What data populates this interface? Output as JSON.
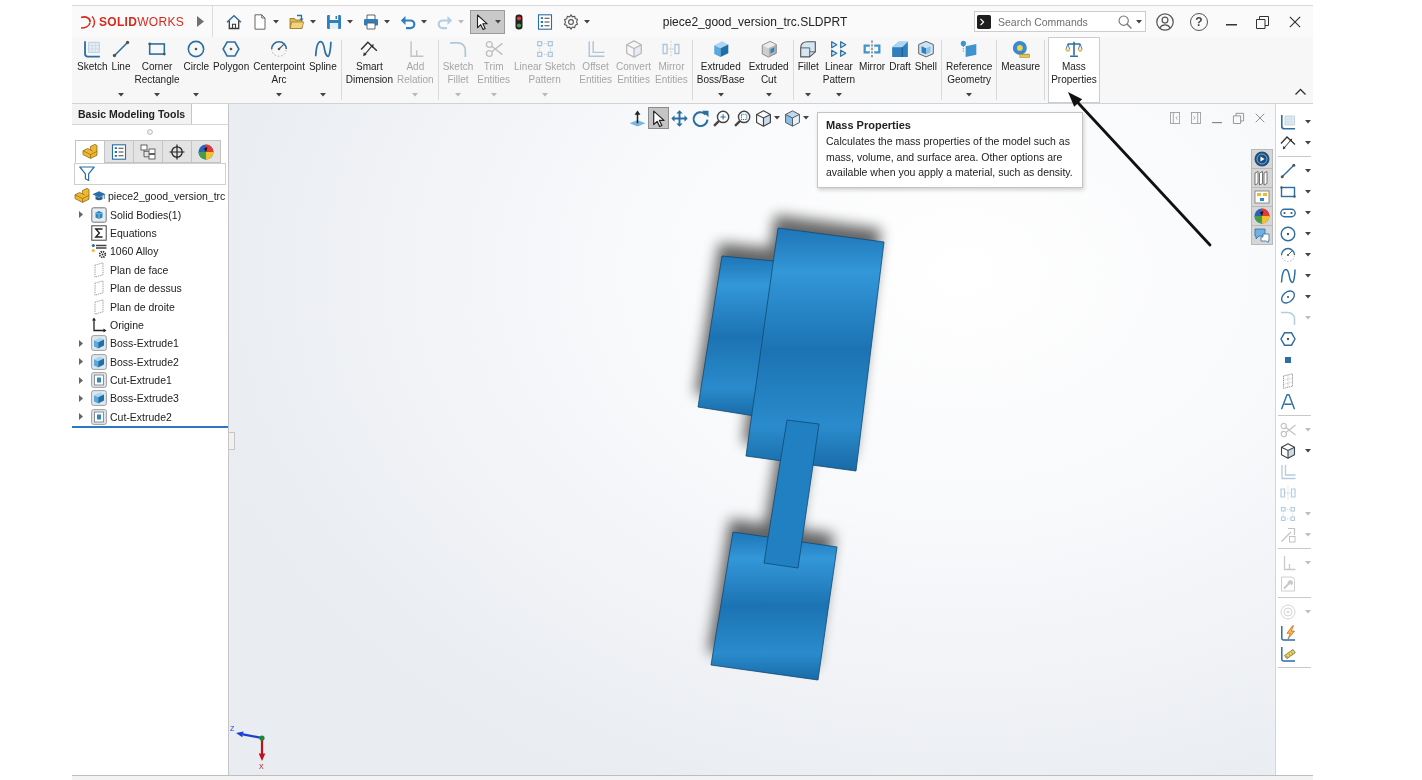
{
  "title_bar": {
    "logo": "**SOLID**WORKS",
    "quick_access": [
      {
        "dropdown": false,
        "disabled": false,
        "pressed": false
      },
      {
        "dropdown": true,
        "disabled": false,
        "pressed": false
      },
      {
        "dropdown": true,
        "disabled": false,
        "pressed": false
      },
      {
        "dropdown": true,
        "disabled": false,
        "pressed": false
      },
      {
        "dropdown": true,
        "disabled": false,
        "pressed": false
      },
      {
        "dropdown": true,
        "disabled": false,
        "pressed": false
      },
      {
        "dropdown": true,
        "disabled": true,
        "pressed": false
      },
      {
        "dropdown": true,
        "disabled": false,
        "pressed": true
      },
      {
        "dropdown": false,
        "disabled": false,
        "pressed": false
      },
      {
        "dropdown": false,
        "disabled": false,
        "pressed": false
      },
      {
        "dropdown": true,
        "disabled": false,
        "pressed": false
      }
    ],
    "document_title": "piece2_good_version_trc.SLDPRT",
    "search": {
      "placeholder": "Search Commands"
    },
    "help": "?"
  },
  "ribbon": {
    "groups": [
      {
        "buttons": [
          {
            "lines": [
              "Sketch"
            ],
            "dropdown": false,
            "disabled": false,
            "selected": false
          },
          {
            "lines": [
              "Line"
            ],
            "dropdown": true,
            "disabled": false,
            "selected": false
          },
          {
            "lines": [
              "Corner",
              "Rectangle"
            ],
            "dropdown": true,
            "disabled": false,
            "selected": false
          },
          {
            "lines": [
              "Circle"
            ],
            "dropdown": true,
            "disabled": false,
            "selected": false
          },
          {
            "lines": [
              "Polygon"
            ],
            "dropdown": false,
            "disabled": false,
            "selected": false
          },
          {
            "lines": [
              "Centerpoint",
              "Arc"
            ],
            "dropdown": true,
            "disabled": false,
            "selected": false
          },
          {
            "lines": [
              "Spline"
            ],
            "dropdown": true,
            "disabled": false,
            "selected": false
          }
        ]
      },
      {
        "buttons": [
          {
            "lines": [
              "Smart",
              "Dimension"
            ],
            "dropdown": false,
            "disabled": false,
            "selected": false
          },
          {
            "lines": [
              "Add",
              "Relation"
            ],
            "dropdown": true,
            "disabled": true,
            "selected": false
          }
        ]
      },
      {
        "buttons": [
          {
            "lines": [
              "Sketch",
              "Fillet"
            ],
            "dropdown": true,
            "disabled": true,
            "selected": false
          },
          {
            "lines": [
              "Trim",
              "Entities"
            ],
            "dropdown": true,
            "disabled": true,
            "selected": false
          },
          {
            "lines": [
              "Linear Sketch",
              "Pattern"
            ],
            "dropdown": true,
            "disabled": true,
            "selected": false
          },
          {
            "lines": [
              "Offset",
              "Entities"
            ],
            "dropdown": false,
            "disabled": true,
            "selected": false
          },
          {
            "lines": [
              "Convert",
              "Entities"
            ],
            "dropdown": false,
            "disabled": true,
            "selected": false
          },
          {
            "lines": [
              "Mirror",
              "Entities"
            ],
            "dropdown": false,
            "disabled": true,
            "selected": false
          }
        ]
      },
      {
        "buttons": [
          {
            "lines": [
              "Extruded",
              "Boss/Base"
            ],
            "dropdown": true,
            "disabled": false,
            "selected": false
          },
          {
            "lines": [
              "Extruded",
              "Cut"
            ],
            "dropdown": true,
            "disabled": false,
            "selected": false
          }
        ]
      },
      {
        "buttons": [
          {
            "lines": [
              "Fillet"
            ],
            "dropdown": true,
            "disabled": false,
            "selected": false
          },
          {
            "lines": [
              "Linear",
              "Pattern"
            ],
            "dropdown": true,
            "disabled": false,
            "selected": false
          },
          {
            "lines": [
              "Mirror"
            ],
            "dropdown": false,
            "disabled": false,
            "selected": false
          },
          {
            "lines": [
              "Draft"
            ],
            "dropdown": false,
            "disabled": false,
            "selected": false
          },
          {
            "lines": [
              "Shell"
            ],
            "dropdown": false,
            "disabled": false,
            "selected": false
          }
        ]
      },
      {
        "buttons": [
          {
            "lines": [
              "Reference",
              "Geometry"
            ],
            "dropdown": true,
            "disabled": false,
            "selected": false
          }
        ]
      },
      {
        "buttons": [
          {
            "lines": [
              "Measure"
            ],
            "dropdown": false,
            "disabled": false,
            "selected": false
          }
        ]
      },
      {
        "buttons": [
          {
            "lines": [
              "Mass",
              "Properties"
            ],
            "dropdown": false,
            "disabled": false,
            "selected": true
          }
        ]
      }
    ]
  },
  "left_panel": {
    "tabs": [
      {
        "label": "Basic Modeling Tools",
        "selected": true
      }
    ],
    "manager_tabs": [
      {
        "selected": true
      },
      {
        "selected": false
      },
      {
        "selected": false
      },
      {
        "selected": false
      },
      {
        "selected": false
      }
    ],
    "tree": [
      {
        "label": "piece2_good_version_trc",
        "kind": "part",
        "expandable": false,
        "children": [
          {
            "label": "Solid Bodies(1)",
            "kind": "bodies",
            "expandable": true
          },
          {
            "label": "Equations",
            "kind": "equations",
            "expandable": false
          },
          {
            "label": "1060 Alloy",
            "kind": "material",
            "expandable": false
          },
          {
            "label": "Plan de face",
            "kind": "plane",
            "expandable": false
          },
          {
            "label": "Plan de dessus",
            "kind": "plane",
            "expandable": false
          },
          {
            "label": "Plan de droite",
            "kind": "plane",
            "expandable": false
          },
          {
            "label": "Origine",
            "kind": "origin",
            "expandable": false
          },
          {
            "label": "Boss-Extrude1",
            "kind": "boss",
            "expandable": true
          },
          {
            "label": "Boss-Extrude2",
            "kind": "boss",
            "expandable": true
          },
          {
            "label": "Cut-Extrude1",
            "kind": "cut",
            "expandable": true
          },
          {
            "label": "Boss-Extrude3",
            "kind": "boss",
            "expandable": true
          },
          {
            "label": "Cut-Extrude2",
            "kind": "cut",
            "expandable": true
          }
        ]
      }
    ]
  },
  "viewport": {
    "view_toolbar": [
      {
        "dropdown": false,
        "pressed": false
      },
      {
        "dropdown": false,
        "pressed": true
      },
      {
        "dropdown": false,
        "pressed": false
      },
      {
        "dropdown": false,
        "pressed": false
      },
      {
        "dropdown": false,
        "pressed": false
      },
      {
        "dropdown": false,
        "pressed": false
      },
      {
        "dropdown": true,
        "pressed": false
      },
      {
        "dropdown": true,
        "pressed": false
      }
    ],
    "tooltip": {
      "title": "Mass Properties",
      "text": "Calculates the mass properties of the model such as mass, volume, and surface area. Other options are available when you apply a material, such as density."
    },
    "triad": {
      "axes": [
        {
          "label": "Z",
          "color": "#1c3fd1"
        },
        {
          "label": "X",
          "color": "#c0101c"
        }
      ]
    }
  },
  "right_toolbar": {
    "groups": [
      {
        "items": [
          {
            "dropdown": true,
            "disabled": false
          },
          {
            "dropdown": true,
            "disabled": false
          }
        ]
      },
      {
        "items": [
          {
            "dropdown": true,
            "disabled": false
          },
          {
            "dropdown": true,
            "disabled": false
          },
          {
            "dropdown": true,
            "disabled": false
          },
          {
            "dropdown": true,
            "disabled": false
          },
          {
            "dropdown": true,
            "disabled": false
          },
          {
            "dropdown": true,
            "disabled": false
          },
          {
            "dropdown": true,
            "disabled": false
          },
          {
            "dropdown": true,
            "disabled": true
          },
          {
            "dropdown": false,
            "disabled": false
          },
          {
            "dropdown": false,
            "disabled": false
          },
          {
            "dropdown": false,
            "disabled": false
          },
          {
            "dropdown": false,
            "disabled": false
          }
        ]
      },
      {
        "items": [
          {
            "dropdown": true,
            "disabled": true
          },
          {
            "dropdown": true,
            "disabled": false
          },
          {
            "dropdown": false,
            "disabled": true
          },
          {
            "dropdown": false,
            "disabled": true
          },
          {
            "dropdown": true,
            "disabled": true
          },
          {
            "dropdown": true,
            "disabled": true
          }
        ]
      },
      {
        "items": [
          {
            "dropdown": true,
            "disabled": true
          },
          {
            "dropdown": false,
            "disabled": true
          }
        ]
      },
      {
        "items": [
          {
            "dropdown": true,
            "disabled": true
          },
          {
            "dropdown": false,
            "disabled": false
          },
          {
            "dropdown": false,
            "disabled": false
          }
        ]
      }
    ]
  }
}
